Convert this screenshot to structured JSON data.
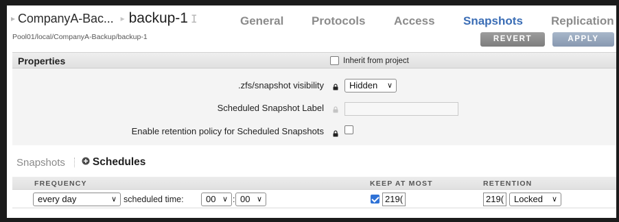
{
  "header": {
    "breadcrumb_parent": "CompanyA-Bac...",
    "breadcrumb_current": "backup-1",
    "tabs": [
      {
        "label": "General"
      },
      {
        "label": "Protocols"
      },
      {
        "label": "Access"
      },
      {
        "label": "Snapshots"
      },
      {
        "label": "Replication"
      }
    ],
    "active_tab": "Snapshots",
    "path": "Pool01/local/CompanyA-Backup/backup-1",
    "revert_label": "REVERT",
    "apply_label": "APPLY"
  },
  "properties": {
    "title": "Properties",
    "inherit_label": "Inherit from project",
    "inherit_checked": false,
    "visibility_label": ".zfs/snapshot visibility",
    "visibility_value": "Hidden",
    "scheduled_label_label": "Scheduled Snapshot Label",
    "scheduled_label_value": "",
    "retention_policy_label": "Enable retention policy for Scheduled Snapshots",
    "retention_policy_checked": false
  },
  "schedules": {
    "tab_snapshots": "Snapshots",
    "tab_schedules": "Schedules",
    "columns": {
      "frequency": "FREQUENCY",
      "keep_at_most": "KEEP AT MOST",
      "retention": "RETENTION"
    },
    "rows": [
      {
        "frequency": "every day",
        "scheduled_time_label": "scheduled time:",
        "hour": "00",
        "time_separator": ":",
        "minute": "00",
        "keep_checked": true,
        "keep_value": "219(",
        "retention_value": "219(",
        "retention_mode": "Locked"
      }
    ]
  },
  "colors": {
    "active_tab": "#3a6db5",
    "inactive_tab": "#8b8b8b",
    "checkbox_checked": "#2f72d6"
  }
}
